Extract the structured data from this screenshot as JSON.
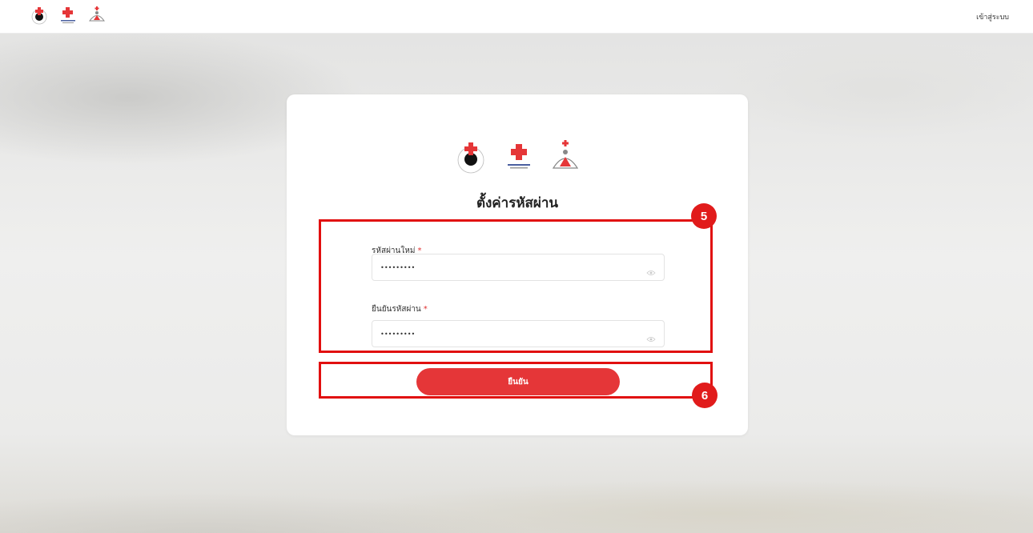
{
  "header": {
    "login_label": "เข้าสู่ระบบ"
  },
  "card": {
    "title": "ตั้งค่ารหัสผ่าน",
    "new_password_label": "รหัสผ่านใหม่",
    "new_password_value": "•••••••••",
    "confirm_password_label": "ยืนยันรหัสผ่าน",
    "confirm_password_value": "•••••••••",
    "required_mark": "*",
    "submit_label": "ยืนยัน"
  },
  "annotations": {
    "badge_5": "5",
    "badge_6": "6"
  },
  "colors": {
    "accent": "#e53638",
    "annotation": "#e10f0f"
  },
  "icons": [
    "red-cross-eye-logo",
    "red-cross-logo",
    "red-cross-emblem-logo",
    "eye-icon"
  ]
}
